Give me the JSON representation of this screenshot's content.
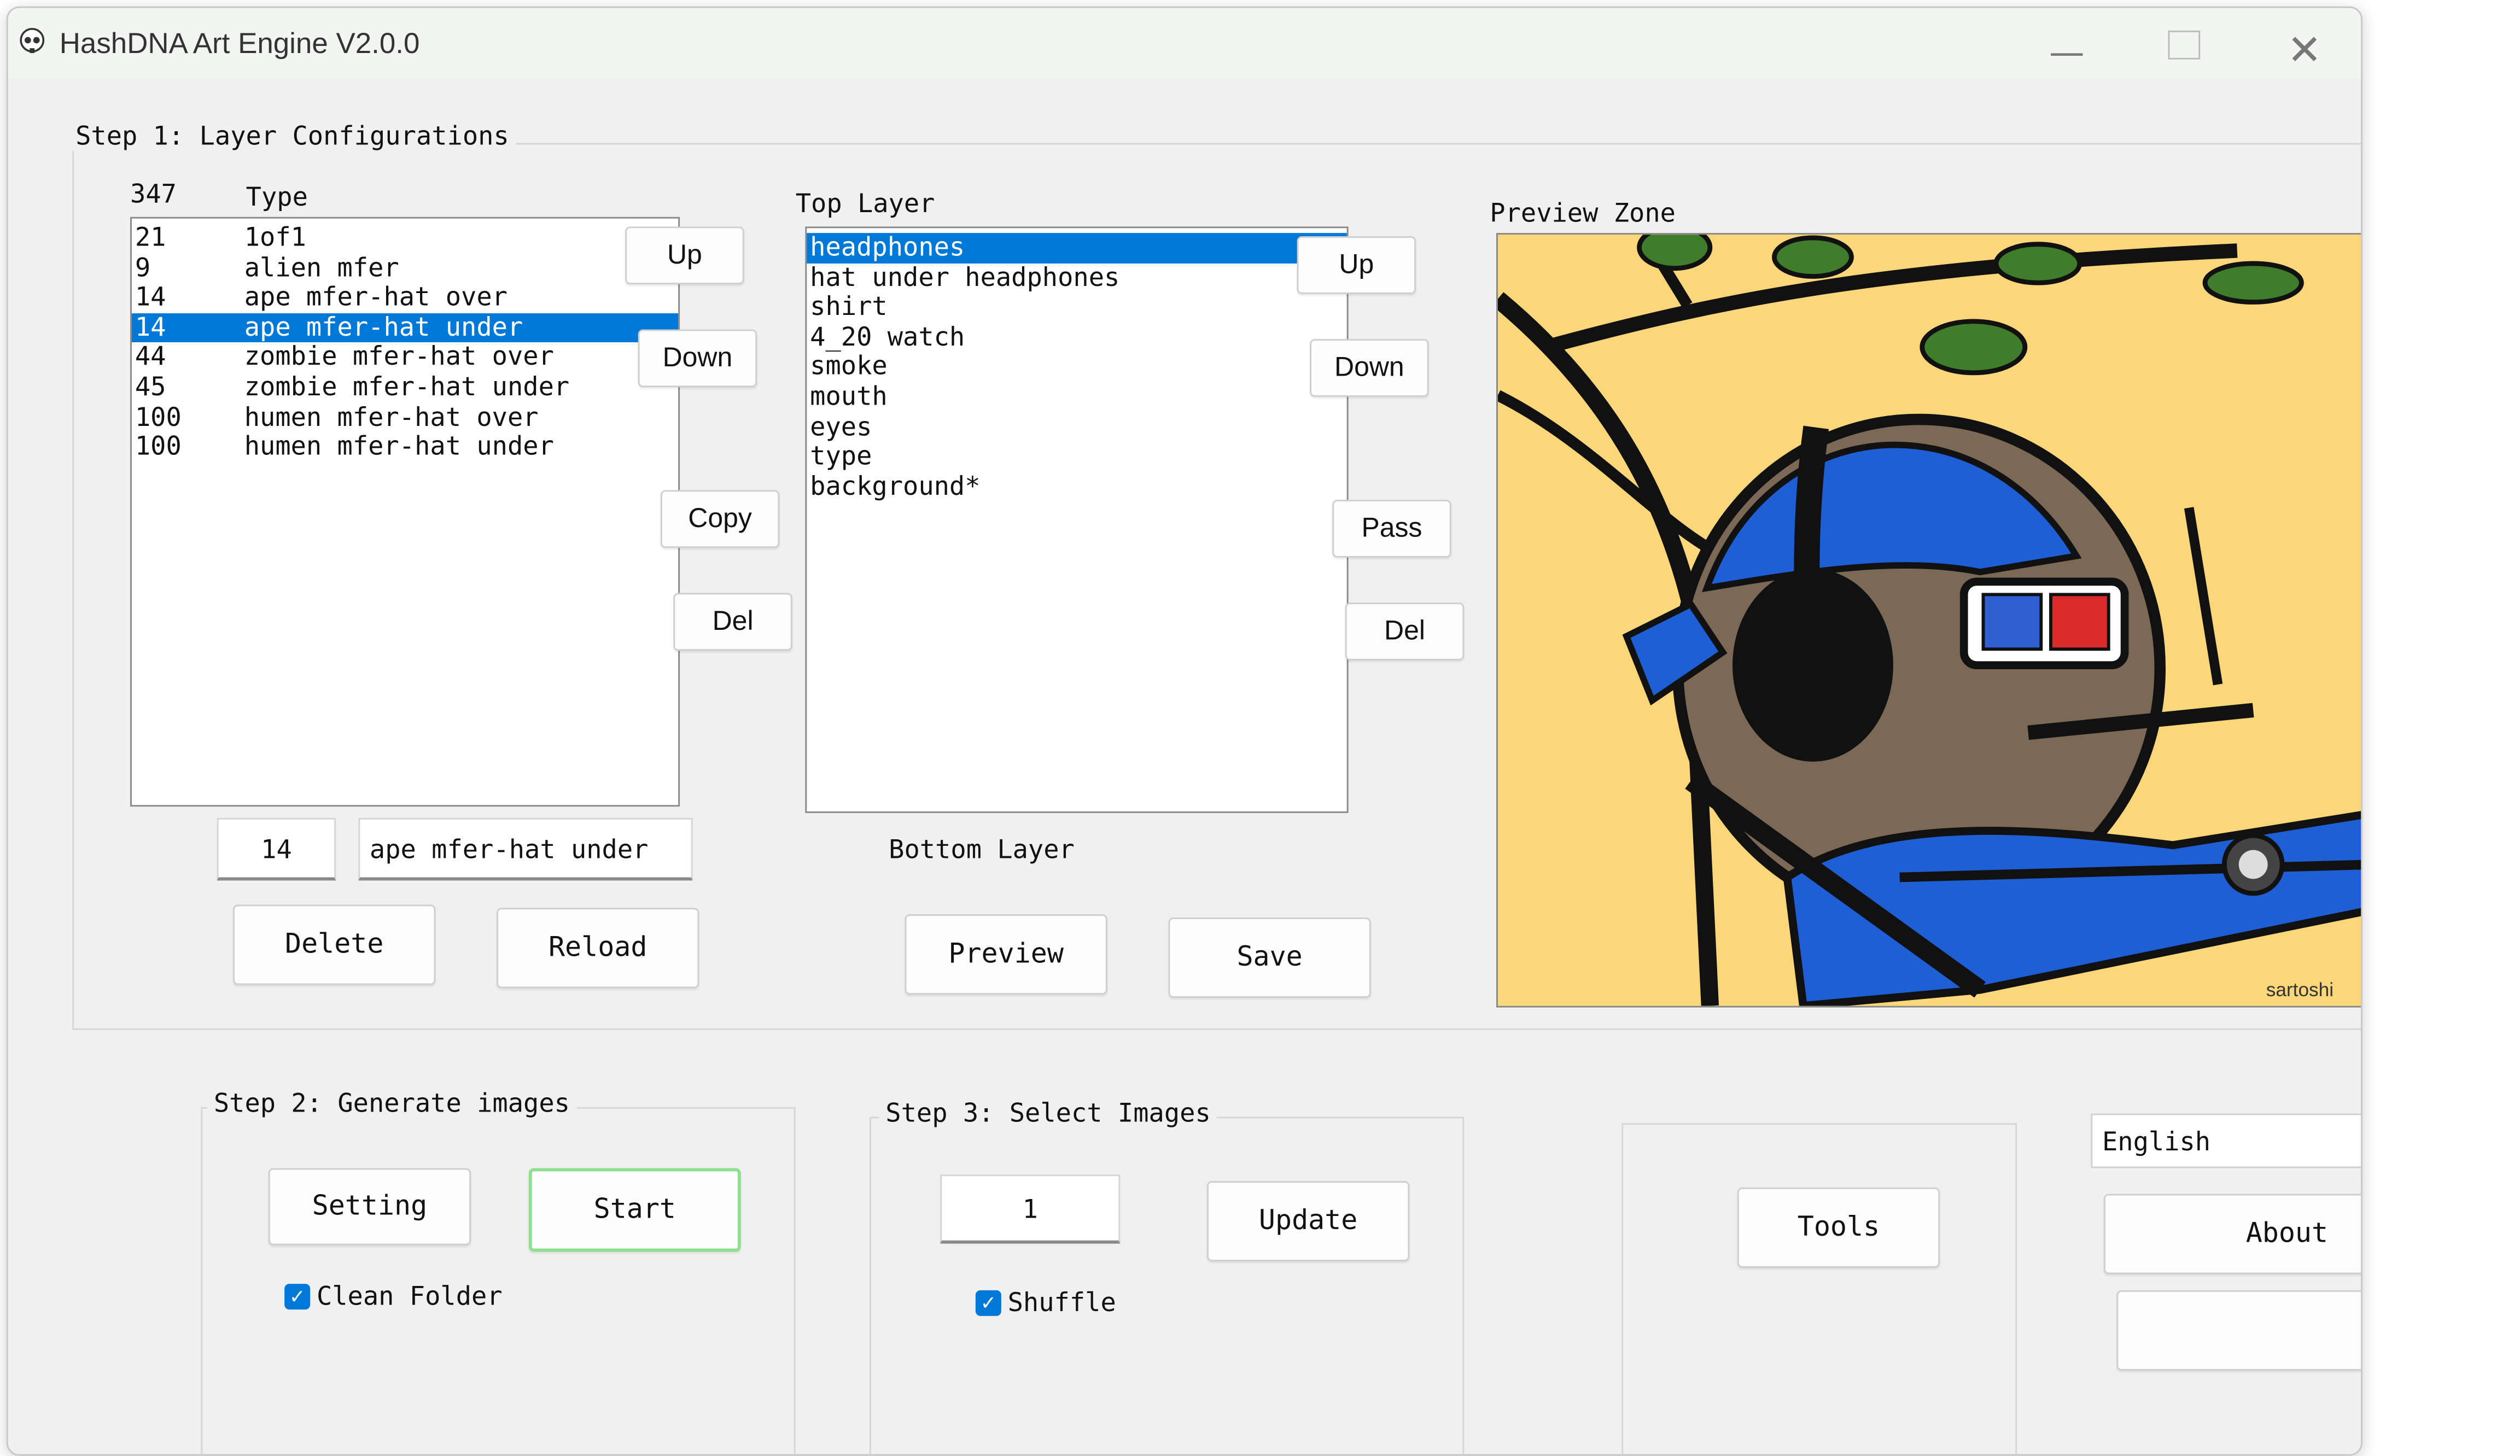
{
  "window": {
    "title": "HashDNA Art Engine V2.0.0"
  },
  "step1": {
    "title": "Step 1: Layer Configurations",
    "type_count": "347",
    "type_header": "Type",
    "type_list": [
      {
        "count": "21",
        "name": "1of1"
      },
      {
        "count": "9",
        "name": "alien mfer"
      },
      {
        "count": "14",
        "name": "ape mfer-hat over"
      },
      {
        "count": "14",
        "name": "ape mfer-hat under"
      },
      {
        "count": "44",
        "name": "zombie mfer-hat over"
      },
      {
        "count": "45",
        "name": "zombie mfer-hat under"
      },
      {
        "count": "100",
        "name": "humen mfer-hat over"
      },
      {
        "count": "100",
        "name": "humen mfer-hat under"
      }
    ],
    "selected_type_index": 3,
    "type_buttons": {
      "up": "Up",
      "down": "Down",
      "copy": "Copy",
      "del": "Del"
    },
    "edit_count_value": "14",
    "edit_name_value": "ape mfer-hat under",
    "delete_label": "Delete",
    "reload_label": "Reload",
    "top_layer_label": "Top Layer",
    "bottom_layer_label": "Bottom Layer",
    "layers": [
      "headphones",
      "hat under headphones",
      "shirt",
      "4_20 watch",
      "smoke",
      "mouth",
      "eyes",
      "type",
      "background*"
    ],
    "selected_layer_index": 0,
    "layer_buttons": {
      "up": "Up",
      "down": "Down",
      "pass": "Pass",
      "del": "Del"
    },
    "preview_label": "Preview",
    "save_label": "Save",
    "preview_zone_label": "Preview Zone",
    "preview_signature": "sartoshi"
  },
  "step2": {
    "title": "Step 2: Generate images",
    "setting_label": "Setting",
    "start_label": "Start",
    "clean_folder_label": "Clean Folder",
    "clean_folder_checked": true
  },
  "step3": {
    "title": "Step 3: Select Images",
    "number_value": "1",
    "update_label": "Update",
    "shuffle_label": "Shuffle",
    "shuffle_checked": true
  },
  "tools_label": "Tools",
  "about_label": "About",
  "language": {
    "selected": "English"
  },
  "colors": {
    "selection": "#0078d7",
    "start_border": "#8fe08f",
    "preview_bg": "#fbd77a"
  }
}
